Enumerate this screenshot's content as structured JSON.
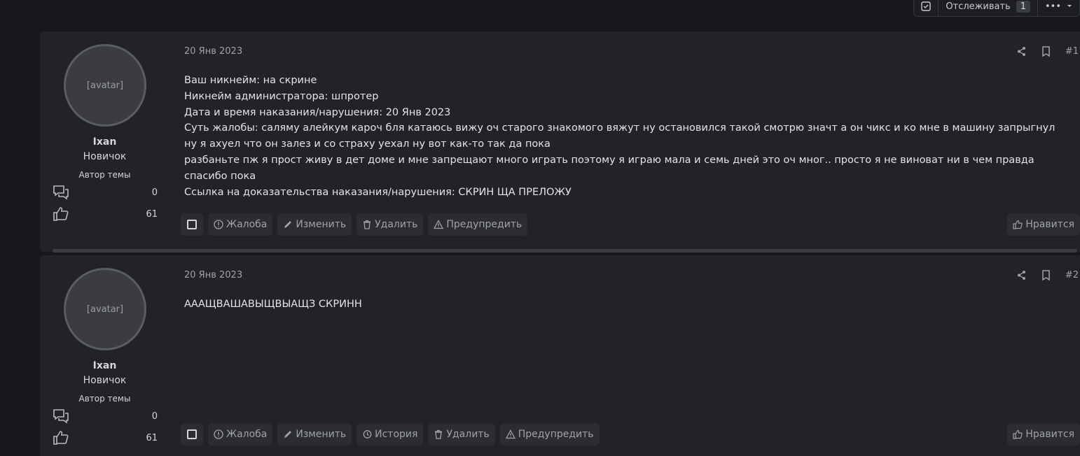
{
  "topbar": {
    "watch_label": "Отслеживать",
    "watch_count": "1",
    "more_label": "•••"
  },
  "posts": [
    {
      "avatar_label": "[avatar]",
      "username": "Ixan",
      "user_title": "Новичок",
      "user_banner": "Автор темы",
      "messages_count": "0",
      "likes_count": "61",
      "date": "20 Янв 2023",
      "post_number": "#1",
      "lines": [
        "Ваш никнейм: на скрине",
        "Никнейм администратора: шпротер",
        "Дата и время наказания/нарушения: 20 Янв 2023",
        "Суть жалобы: саляму алейкум кароч бля катаюсь вижу оч старого знакомого вяжут ну остановился такой смотрю значт а он чикс и ко мне в машину запрыгнул ну я ахуел что он залез и со страху уехал ну вот как-то так да пока",
        "разбаньте пж я прост живу в дет доме и мне запрещают много играть поэтому я играю мала и семь дней это оч мног.. просто я не виноват ни в чем правда спасибо пока",
        "Ссылка на доказательства наказания/нарушения: СКРИН ЩА ПРЕЛОЖУ"
      ],
      "buttons": {
        "report": "Жалоба",
        "edit": "Изменить",
        "delete": "Удалить",
        "warn": "Предупредить",
        "like": "Нравится"
      }
    },
    {
      "avatar_label": "[avatar]",
      "username": "Ixan",
      "user_title": "Новичок",
      "user_banner": "Автор темы",
      "messages_count": "0",
      "likes_count": "61",
      "date": "20 Янв 2023",
      "post_number": "#2",
      "lines": [
        "АААЩВАШАВЫЩВЫАЩЗ СКРИНН"
      ],
      "buttons": {
        "report": "Жалоба",
        "edit": "Изменить",
        "history": "История",
        "delete": "Удалить",
        "warn": "Предупредить",
        "like": "Нравится"
      }
    }
  ],
  "icons": {
    "messages": "speech-bubbles-icon",
    "likes": "thumbs-up-icon",
    "share": "share-icon",
    "bookmark": "bookmark-icon"
  }
}
